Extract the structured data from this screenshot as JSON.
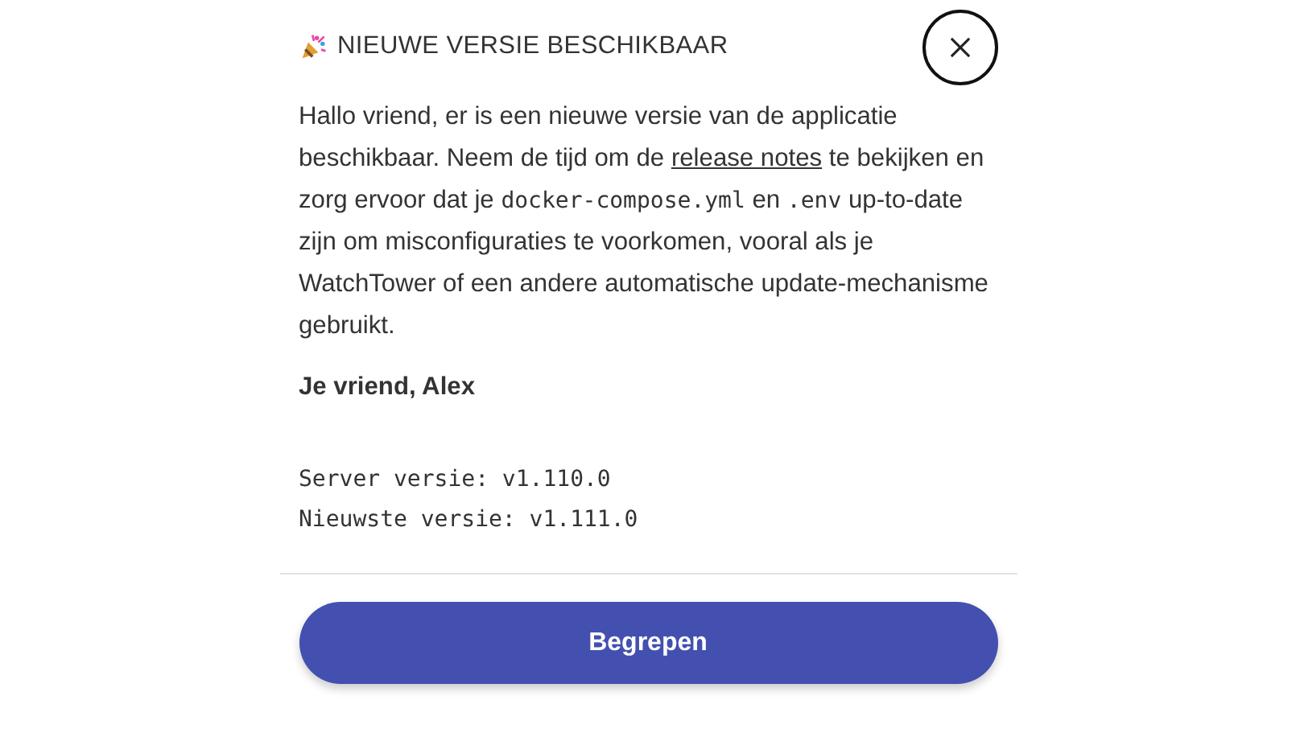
{
  "dialog": {
    "title": "NIEUWE VERSIE BESCHIKBAAR",
    "message": [
      {
        "kind": "text",
        "text": "Hallo vriend, er is een nieuwe versie van de applicatie beschikbaar. Neem de tijd om de "
      },
      {
        "kind": "link",
        "text": "release notes"
      },
      {
        "kind": "text",
        "text": " te bekijken en zorg ervoor dat je "
      },
      {
        "kind": "code",
        "text": "docker-compose.yml"
      },
      {
        "kind": "text",
        "text": " en "
      },
      {
        "kind": "code",
        "text": ".env"
      },
      {
        "kind": "text",
        "text": " up-to-date zijn om misconfiguraties te voorkomen, vooral als je WatchTower of een andere automatische update-mechanisme gebruikt."
      }
    ],
    "signature": "Je vriend, Alex",
    "versions": [
      "Server versie: v1.110.0",
      "Nieuwste versie: v1.111.0"
    ],
    "button": "Begrepen"
  }
}
